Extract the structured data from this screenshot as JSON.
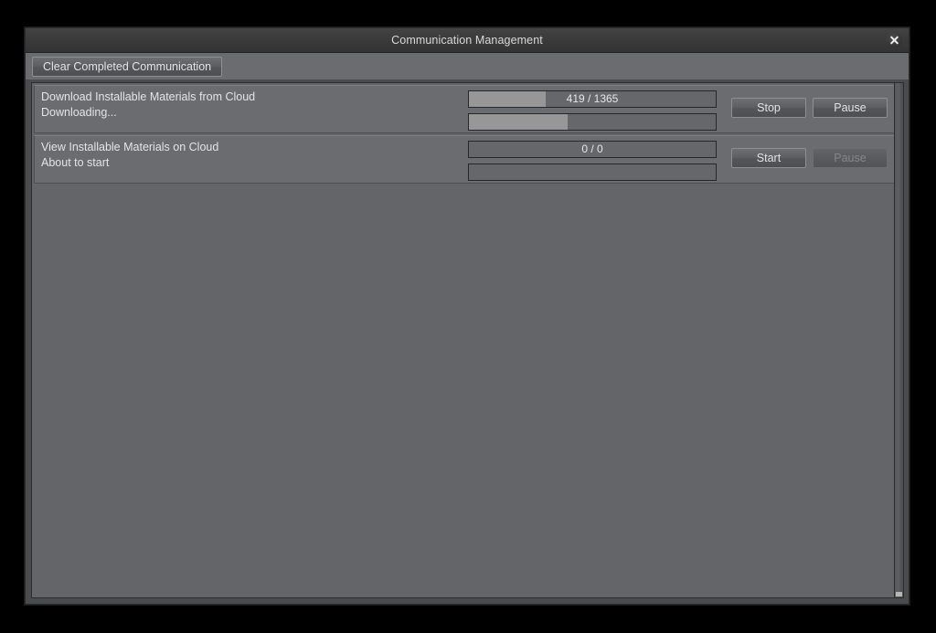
{
  "window": {
    "title": "Communication Management",
    "close_icon": "close-x-icon"
  },
  "toolbar": {
    "clear_label": "Clear Completed Communication"
  },
  "colors": {
    "dialog_bg": "#4a4b4d",
    "titlebar_bg": "#3a3a3b",
    "panel_bg": "#6b6c70",
    "list_bg": "#636569",
    "progress_fill": "#979798",
    "progress_track": "#65676b",
    "text": "#e4e4e5",
    "text_disabled": "#85868a"
  },
  "tasks": [
    {
      "title": "Download Installable Materials from Cloud",
      "status": "Downloading...",
      "primary_progress": {
        "text": "419 / 1365",
        "current": 419,
        "total": 1365,
        "percent": 31
      },
      "secondary_progress": {
        "text": "",
        "percent": 40
      },
      "buttons": [
        {
          "label": "Stop",
          "name": "stop-button",
          "disabled": false
        },
        {
          "label": "Pause",
          "name": "pause-button",
          "disabled": false
        }
      ]
    },
    {
      "title": "View Installable Materials on Cloud",
      "status": "About to start",
      "primary_progress": {
        "text": "0 / 0",
        "current": 0,
        "total": 0,
        "percent": 0
      },
      "secondary_progress": {
        "text": "",
        "percent": 0
      },
      "buttons": [
        {
          "label": "Start",
          "name": "start-button",
          "disabled": false
        },
        {
          "label": "Pause",
          "name": "pause-button",
          "disabled": true
        }
      ]
    }
  ]
}
